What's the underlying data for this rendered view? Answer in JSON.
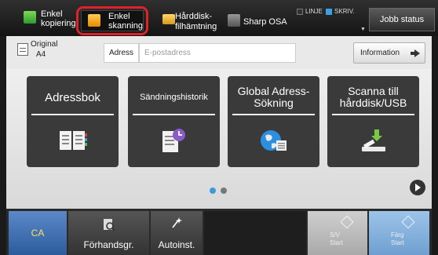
{
  "top_bar": {
    "modes": [
      {
        "label": "Enkel\nkopiering",
        "icon": "copy-mode-icon"
      },
      {
        "label": "Enkel\nskanning",
        "icon": "scan-mode-icon",
        "selected": true
      },
      {
        "label": "Hårddisk-\nfilhämtning",
        "icon": "folder-icon"
      },
      {
        "label": "Sharp OSA",
        "icon": "osa-icon"
      }
    ],
    "status_line": "LINJE",
    "status_print": "SKRIV.",
    "job_status": "Jobb status",
    "highlight_color": "#e0202a"
  },
  "address_row": {
    "original_label": "Original",
    "original_size": "A4",
    "address_tab": "Adress",
    "email_placeholder": "E-postadress",
    "information_button": "Information"
  },
  "tiles": [
    {
      "label": "Adressbok",
      "icon": "address-book-icon"
    },
    {
      "label": "Sändningshistorik",
      "icon": "history-icon"
    },
    {
      "label": "Global Adress-\nSökning",
      "icon": "global-search-icon"
    },
    {
      "label": "Scanna till\nhårddisk/USB",
      "icon": "usb-icon"
    }
  ],
  "pager": {
    "current": 1,
    "total": 2
  },
  "bottom_bar": {
    "ca": "CA",
    "preview": "Förhandsgr.",
    "auto": "Autoinst.",
    "bw_start": "S/V\nStart",
    "color_start": "Färg\nStart",
    "ca_color": "#3a6fb3",
    "color_start_color": "#7fb0e0"
  }
}
